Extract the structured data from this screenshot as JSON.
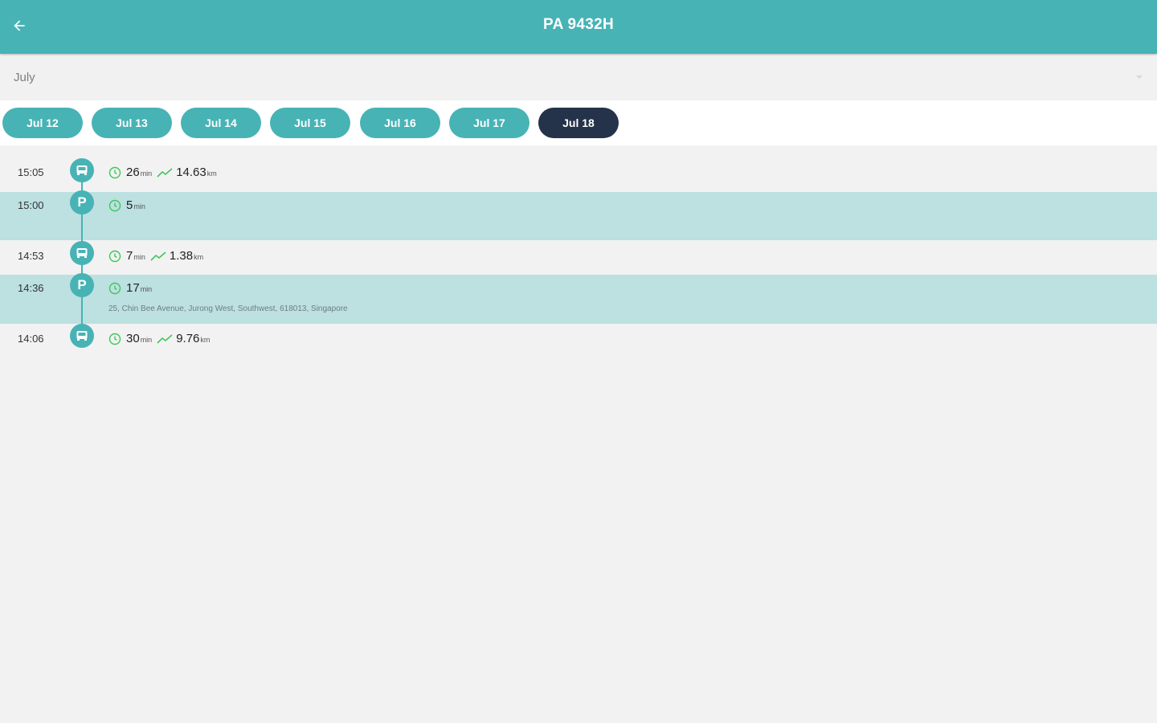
{
  "app": {
    "title": "PA 9432H"
  },
  "month": {
    "label": "July"
  },
  "dates": [
    "Jul 12",
    "Jul 13",
    "Jul 14",
    "Jul 15",
    "Jul 16",
    "Jul 17",
    "Jul 18"
  ],
  "selected_date": "Jul 18",
  "colors": {
    "primary": "#47b3b5",
    "selected_chip": "#24334a",
    "parking_row": "#bde0e1",
    "accent_green": "#3cc85a",
    "background": "#f2f2f2"
  },
  "timeline": [
    {
      "time": "15:05",
      "type": "drive",
      "icon": "car-icon",
      "duration": "26",
      "duration_unit": "min",
      "distance": "14.63",
      "distance_unit": "km"
    },
    {
      "time": "15:00",
      "type": "parking",
      "icon": "parking-icon",
      "marker_text": "P",
      "duration": "5",
      "duration_unit": "min"
    },
    {
      "time": "14:53",
      "type": "drive",
      "icon": "car-icon",
      "duration": "7",
      "duration_unit": "min",
      "distance": "1.38",
      "distance_unit": "km"
    },
    {
      "time": "14:36",
      "type": "parking",
      "icon": "parking-icon",
      "marker_text": "P",
      "duration": "17",
      "duration_unit": "min",
      "address": "25, Chin Bee Avenue, Jurong West, Southwest, 618013, Singapore"
    },
    {
      "time": "14:06",
      "type": "drive",
      "icon": "car-icon",
      "duration": "30",
      "duration_unit": "min",
      "distance": "9.76",
      "distance_unit": "km"
    }
  ]
}
